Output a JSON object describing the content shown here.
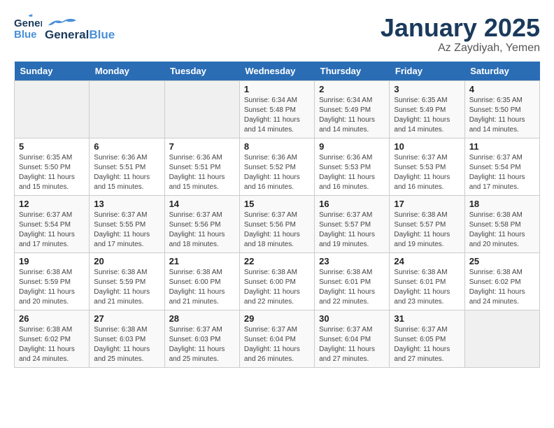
{
  "header": {
    "logo": {
      "general": "General",
      "blue": "Blue"
    },
    "title": "January 2025",
    "subtitle": "Az Zaydiyah, Yemen"
  },
  "weekdays": [
    "Sunday",
    "Monday",
    "Tuesday",
    "Wednesday",
    "Thursday",
    "Friday",
    "Saturday"
  ],
  "weeks": [
    [
      {
        "day": "",
        "sunrise": "",
        "sunset": "",
        "daylight": ""
      },
      {
        "day": "",
        "sunrise": "",
        "sunset": "",
        "daylight": ""
      },
      {
        "day": "",
        "sunrise": "",
        "sunset": "",
        "daylight": ""
      },
      {
        "day": "1",
        "sunrise": "Sunrise: 6:34 AM",
        "sunset": "Sunset: 5:48 PM",
        "daylight": "Daylight: 11 hours and 14 minutes."
      },
      {
        "day": "2",
        "sunrise": "Sunrise: 6:34 AM",
        "sunset": "Sunset: 5:49 PM",
        "daylight": "Daylight: 11 hours and 14 minutes."
      },
      {
        "day": "3",
        "sunrise": "Sunrise: 6:35 AM",
        "sunset": "Sunset: 5:49 PM",
        "daylight": "Daylight: 11 hours and 14 minutes."
      },
      {
        "day": "4",
        "sunrise": "Sunrise: 6:35 AM",
        "sunset": "Sunset: 5:50 PM",
        "daylight": "Daylight: 11 hours and 14 minutes."
      }
    ],
    [
      {
        "day": "5",
        "sunrise": "Sunrise: 6:35 AM",
        "sunset": "Sunset: 5:50 PM",
        "daylight": "Daylight: 11 hours and 15 minutes."
      },
      {
        "day": "6",
        "sunrise": "Sunrise: 6:36 AM",
        "sunset": "Sunset: 5:51 PM",
        "daylight": "Daylight: 11 hours and 15 minutes."
      },
      {
        "day": "7",
        "sunrise": "Sunrise: 6:36 AM",
        "sunset": "Sunset: 5:51 PM",
        "daylight": "Daylight: 11 hours and 15 minutes."
      },
      {
        "day": "8",
        "sunrise": "Sunrise: 6:36 AM",
        "sunset": "Sunset: 5:52 PM",
        "daylight": "Daylight: 11 hours and 16 minutes."
      },
      {
        "day": "9",
        "sunrise": "Sunrise: 6:36 AM",
        "sunset": "Sunset: 5:53 PM",
        "daylight": "Daylight: 11 hours and 16 minutes."
      },
      {
        "day": "10",
        "sunrise": "Sunrise: 6:37 AM",
        "sunset": "Sunset: 5:53 PM",
        "daylight": "Daylight: 11 hours and 16 minutes."
      },
      {
        "day": "11",
        "sunrise": "Sunrise: 6:37 AM",
        "sunset": "Sunset: 5:54 PM",
        "daylight": "Daylight: 11 hours and 17 minutes."
      }
    ],
    [
      {
        "day": "12",
        "sunrise": "Sunrise: 6:37 AM",
        "sunset": "Sunset: 5:54 PM",
        "daylight": "Daylight: 11 hours and 17 minutes."
      },
      {
        "day": "13",
        "sunrise": "Sunrise: 6:37 AM",
        "sunset": "Sunset: 5:55 PM",
        "daylight": "Daylight: 11 hours and 17 minutes."
      },
      {
        "day": "14",
        "sunrise": "Sunrise: 6:37 AM",
        "sunset": "Sunset: 5:56 PM",
        "daylight": "Daylight: 11 hours and 18 minutes."
      },
      {
        "day": "15",
        "sunrise": "Sunrise: 6:37 AM",
        "sunset": "Sunset: 5:56 PM",
        "daylight": "Daylight: 11 hours and 18 minutes."
      },
      {
        "day": "16",
        "sunrise": "Sunrise: 6:37 AM",
        "sunset": "Sunset: 5:57 PM",
        "daylight": "Daylight: 11 hours and 19 minutes."
      },
      {
        "day": "17",
        "sunrise": "Sunrise: 6:38 AM",
        "sunset": "Sunset: 5:57 PM",
        "daylight": "Daylight: 11 hours and 19 minutes."
      },
      {
        "day": "18",
        "sunrise": "Sunrise: 6:38 AM",
        "sunset": "Sunset: 5:58 PM",
        "daylight": "Daylight: 11 hours and 20 minutes."
      }
    ],
    [
      {
        "day": "19",
        "sunrise": "Sunrise: 6:38 AM",
        "sunset": "Sunset: 5:59 PM",
        "daylight": "Daylight: 11 hours and 20 minutes."
      },
      {
        "day": "20",
        "sunrise": "Sunrise: 6:38 AM",
        "sunset": "Sunset: 5:59 PM",
        "daylight": "Daylight: 11 hours and 21 minutes."
      },
      {
        "day": "21",
        "sunrise": "Sunrise: 6:38 AM",
        "sunset": "Sunset: 6:00 PM",
        "daylight": "Daylight: 11 hours and 21 minutes."
      },
      {
        "day": "22",
        "sunrise": "Sunrise: 6:38 AM",
        "sunset": "Sunset: 6:00 PM",
        "daylight": "Daylight: 11 hours and 22 minutes."
      },
      {
        "day": "23",
        "sunrise": "Sunrise: 6:38 AM",
        "sunset": "Sunset: 6:01 PM",
        "daylight": "Daylight: 11 hours and 22 minutes."
      },
      {
        "day": "24",
        "sunrise": "Sunrise: 6:38 AM",
        "sunset": "Sunset: 6:01 PM",
        "daylight": "Daylight: 11 hours and 23 minutes."
      },
      {
        "day": "25",
        "sunrise": "Sunrise: 6:38 AM",
        "sunset": "Sunset: 6:02 PM",
        "daylight": "Daylight: 11 hours and 24 minutes."
      }
    ],
    [
      {
        "day": "26",
        "sunrise": "Sunrise: 6:38 AM",
        "sunset": "Sunset: 6:02 PM",
        "daylight": "Daylight: 11 hours and 24 minutes."
      },
      {
        "day": "27",
        "sunrise": "Sunrise: 6:38 AM",
        "sunset": "Sunset: 6:03 PM",
        "daylight": "Daylight: 11 hours and 25 minutes."
      },
      {
        "day": "28",
        "sunrise": "Sunrise: 6:37 AM",
        "sunset": "Sunset: 6:03 PM",
        "daylight": "Daylight: 11 hours and 25 minutes."
      },
      {
        "day": "29",
        "sunrise": "Sunrise: 6:37 AM",
        "sunset": "Sunset: 6:04 PM",
        "daylight": "Daylight: 11 hours and 26 minutes."
      },
      {
        "day": "30",
        "sunrise": "Sunrise: 6:37 AM",
        "sunset": "Sunset: 6:04 PM",
        "daylight": "Daylight: 11 hours and 27 minutes."
      },
      {
        "day": "31",
        "sunrise": "Sunrise: 6:37 AM",
        "sunset": "Sunset: 6:05 PM",
        "daylight": "Daylight: 11 hours and 27 minutes."
      },
      {
        "day": "",
        "sunrise": "",
        "sunset": "",
        "daylight": ""
      }
    ]
  ]
}
